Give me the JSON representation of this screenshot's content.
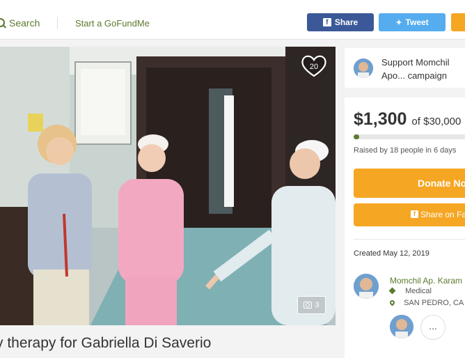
{
  "header": {
    "search_label": "Search",
    "start_label": "Start a GoFundMe",
    "share_label": "Share",
    "tweet_label": "Tweet"
  },
  "media": {
    "heart_count": "20",
    "photo_count": "3"
  },
  "campaign": {
    "title": "y therapy for Gabriella Di Saverio"
  },
  "support": {
    "text": "Support Momchil Apo... campaign"
  },
  "donation": {
    "amount": "$1,300",
    "goal": "of $30,000",
    "progress_fraction": 0.043,
    "raised_text": "Raised by 18 people in 6 days",
    "donate_label": "Donate No",
    "share_fb_label": "Share on Fac"
  },
  "details": {
    "created": "Created May 12, 2019",
    "organizer": "Momchil Ap. Karam",
    "category": "Medical",
    "location": "SAN PEDRO, CA",
    "more_label": "..."
  },
  "colors": {
    "brand_green": "#5a7a2e",
    "facebook": "#3b5998",
    "twitter": "#55acee",
    "donate_orange": "#f5a623"
  }
}
